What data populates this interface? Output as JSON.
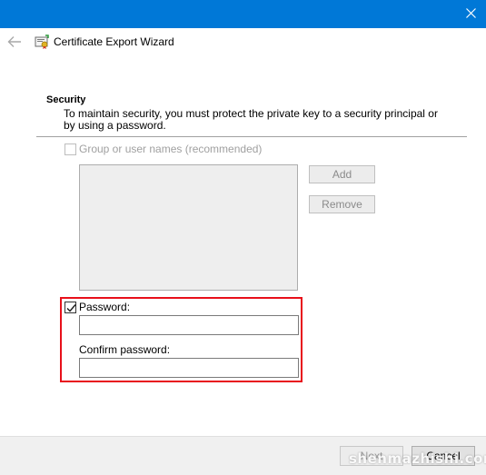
{
  "window": {
    "title": "Certificate Export Wizard",
    "close_icon": "close-icon",
    "back_icon": "back-arrow-icon",
    "app_icon": "certificate-wizard-icon",
    "titlebar_color": "#0078d7"
  },
  "security": {
    "heading": "Security",
    "description": "To maintain security, you must protect the private key to a security principal or by using a password.",
    "group_checkbox_label": "Group or user names (recommended)",
    "group_checkbox_checked": false,
    "group_checkbox_enabled": false,
    "add_label": "Add",
    "remove_label": "Remove",
    "password_checkbox_label": "Password:",
    "password_checkbox_checked": true,
    "password_value": "",
    "confirm_label": "Confirm password:",
    "confirm_value": "",
    "highlight_color": "#e8101a"
  },
  "footer": {
    "next_label": "Next",
    "cancel_label": "Cancel"
  },
  "watermark": "shenmazhishi.com"
}
